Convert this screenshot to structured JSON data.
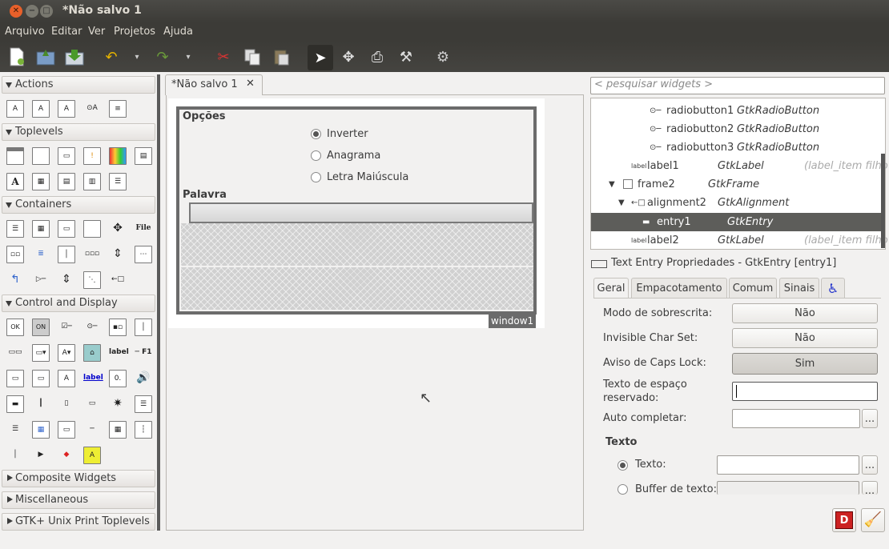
{
  "window": {
    "title": "*Não salvo 1"
  },
  "menu": [
    "Arquivo",
    "Editar",
    "Ver",
    "Projetos",
    "Ajuda"
  ],
  "palette": {
    "categories": [
      "Actions",
      "Toplevels",
      "Containers",
      "Control and Display",
      "Composite Widgets",
      "Miscellaneous",
      "GTK+ Unix Print Toplevels"
    ],
    "icon_file": "File",
    "icon_label": "label",
    "icon_label2": "label",
    "icon_f1": "─ F1",
    "icon_ok": "OK",
    "icon_on": "ON",
    "icon_a": "A"
  },
  "editor": {
    "tab": "*Não salvo 1",
    "frame1_label": "Opções",
    "radio1": "Inverter",
    "radio2": "Anagrama",
    "radio3": "Letra Maiúscula",
    "frame2_label": "Palavra",
    "window_label": "window1"
  },
  "search": {
    "placeholder": "< pesquisar widgets >"
  },
  "tree": [
    {
      "name": "radiobutton1",
      "type": "GtkRadioButton",
      "extra": ""
    },
    {
      "name": "radiobutton2",
      "type": "GtkRadioButton",
      "extra": ""
    },
    {
      "name": "radiobutton3",
      "type": "GtkRadioButton",
      "extra": ""
    },
    {
      "name": "label1",
      "type": "GtkLabel",
      "extra": "(label_item filho"
    },
    {
      "name": "frame2",
      "type": "GtkFrame",
      "extra": ""
    },
    {
      "name": "alignment2",
      "type": "GtkAlignment",
      "extra": ""
    },
    {
      "name": "entry1",
      "type": "GtkEntry",
      "extra": ""
    },
    {
      "name": "label2",
      "type": "GtkLabel",
      "extra": "(label_item filho"
    }
  ],
  "props": {
    "header": "Text Entry Propriedades - GtkEntry [entry1]",
    "tabs": [
      "Geral",
      "Empacotamento",
      "Comum",
      "Sinais"
    ],
    "rows": {
      "overwrite_label": "Modo de sobrescrita:",
      "overwrite_value": "Não",
      "invis_label": "Invisible Char Set:",
      "invis_value": "Não",
      "caps_label": "Aviso de Caps Lock:",
      "caps_value": "Sim",
      "placeholder_label": "Texto de espaço reservado:",
      "autocomplete_label": "Auto completar:",
      "texto_section": "Texto",
      "texto_label": "Texto:",
      "buffer_label": "Buffer de texto:",
      "ellipsis": "..."
    }
  }
}
